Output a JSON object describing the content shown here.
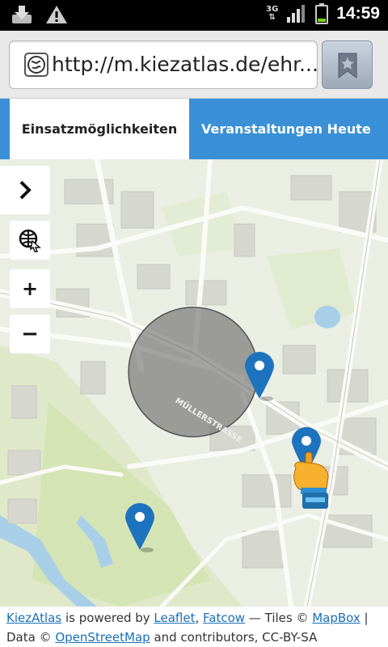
{
  "status_bar": {
    "time": "14:59",
    "network": "3G",
    "icons": [
      "download-icon",
      "warning-icon",
      "signal-icon",
      "battery-icon"
    ]
  },
  "browser": {
    "url": "http://m.kiezatlas.de/ehr...",
    "icons": [
      "globe-icon",
      "bookmark-star-icon"
    ]
  },
  "tabs": [
    {
      "label": "Einsatzmöglichkeiten",
      "active": true
    },
    {
      "label": "Veranstaltungen Heute",
      "active": false
    }
  ],
  "map": {
    "street_label": "MÜLLERSTRASSE",
    "controls": {
      "zoom_in": "+",
      "zoom_out": "−"
    },
    "markers": 3,
    "colors": {
      "accent": "#3a90d6",
      "marker": "#1e73be",
      "circle": "#6b6b6b"
    }
  },
  "attribution": {
    "kiezatlas": "KiezAtlas",
    "powered": " is powered by ",
    "leaflet": "Leaflet",
    "sep1": ", ",
    "fatcow": "Fatcow",
    "tiles": " — Tiles © ",
    "mapbox": "MapBox",
    "sep2": " |",
    "data": "Data © ",
    "osm": "OpenStreetMap",
    "contrib": " and contributors, CC-BY-SA"
  }
}
